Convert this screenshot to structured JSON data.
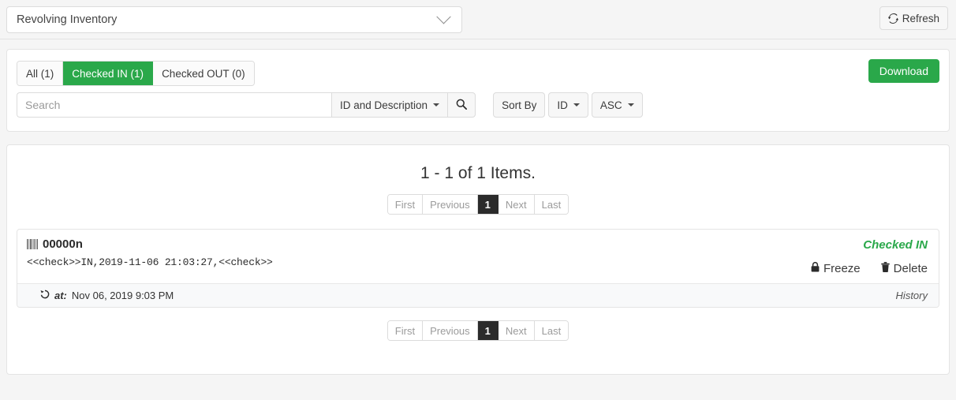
{
  "topbar": {
    "inventory_select": {
      "value": "Revolving Inventory",
      "icon": "chevron-down-icon"
    },
    "refresh_label": "Refresh",
    "refresh_icon": "refresh-icon"
  },
  "controls": {
    "tabs": [
      {
        "label": "All (1)",
        "active": false
      },
      {
        "label": "Checked IN (1)",
        "active": true
      },
      {
        "label": "Checked OUT (0)",
        "active": false
      }
    ],
    "download_label": "Download",
    "search": {
      "value": "",
      "placeholder": "Search",
      "field_selector_label": "ID and Description",
      "search_icon": "magnifier-icon"
    },
    "sort": {
      "label": "Sort By",
      "field_label": "ID",
      "direction_label": "ASC"
    }
  },
  "results": {
    "heading": "1 - 1 of 1 Items.",
    "pagination": [
      {
        "label": "First",
        "active": false
      },
      {
        "label": "Previous",
        "active": false
      },
      {
        "label": "1",
        "active": true
      },
      {
        "label": "Next",
        "active": false
      },
      {
        "label": "Last",
        "active": false
      }
    ],
    "item": {
      "barcode_icon": "barcode-icon",
      "id": "00000n",
      "description": "<<check>>IN,2019-11-06 21:03:27,<<check>>",
      "status": "Checked IN",
      "status_color": "#2aa84a",
      "freeze_label": "Freeze",
      "freeze_icon": "lock-icon",
      "delete_label": "Delete",
      "delete_icon": "trash-icon",
      "footer": {
        "history_icon": "undo-history-icon",
        "at_label": "at:",
        "timestamp": "Nov 06, 2019 9:03 PM",
        "history_link": "History"
      }
    }
  },
  "colors": {
    "accent_green": "#2aa84a",
    "page_background": "#f5f5f5",
    "active_page": "#2b2b2b"
  }
}
